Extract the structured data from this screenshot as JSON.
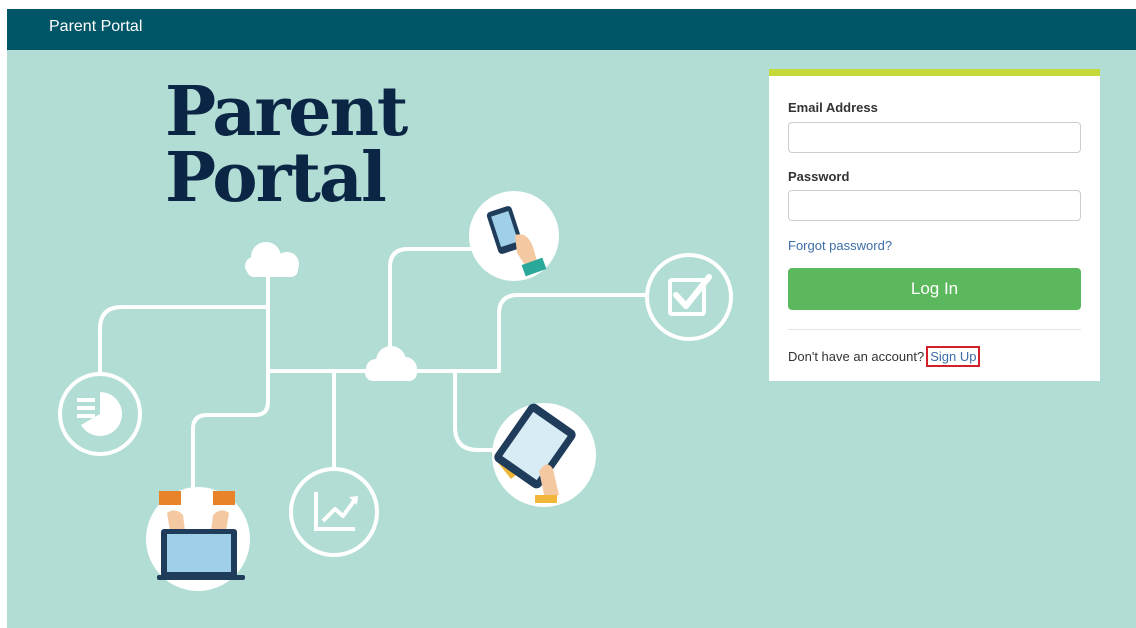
{
  "topbar": {
    "title": "Parent Portal"
  },
  "hero": {
    "line1": "Parent",
    "line2": "Portal"
  },
  "login": {
    "email_label": "Email Address",
    "email_value": "",
    "password_label": "Password",
    "password_value": "",
    "forgot_label": "Forgot password?",
    "login_button_label": "Log In",
    "no_account_text": "Don't have an account?",
    "signup_label": "Sign Up"
  },
  "icons": [
    "cloud-icon",
    "smartphone-icon",
    "checklist-icon",
    "pie-chart-icon",
    "laptop-icon",
    "growth-chart-icon",
    "tablet-icon"
  ],
  "colors": {
    "topbar": "#005566",
    "background": "#b2ddd5",
    "accent_bar": "#c5d93a",
    "login_button": "#5cb85c",
    "link": "#3c6ea8",
    "highlight_box": "#d0212a",
    "hero_text": "#0b2545"
  }
}
